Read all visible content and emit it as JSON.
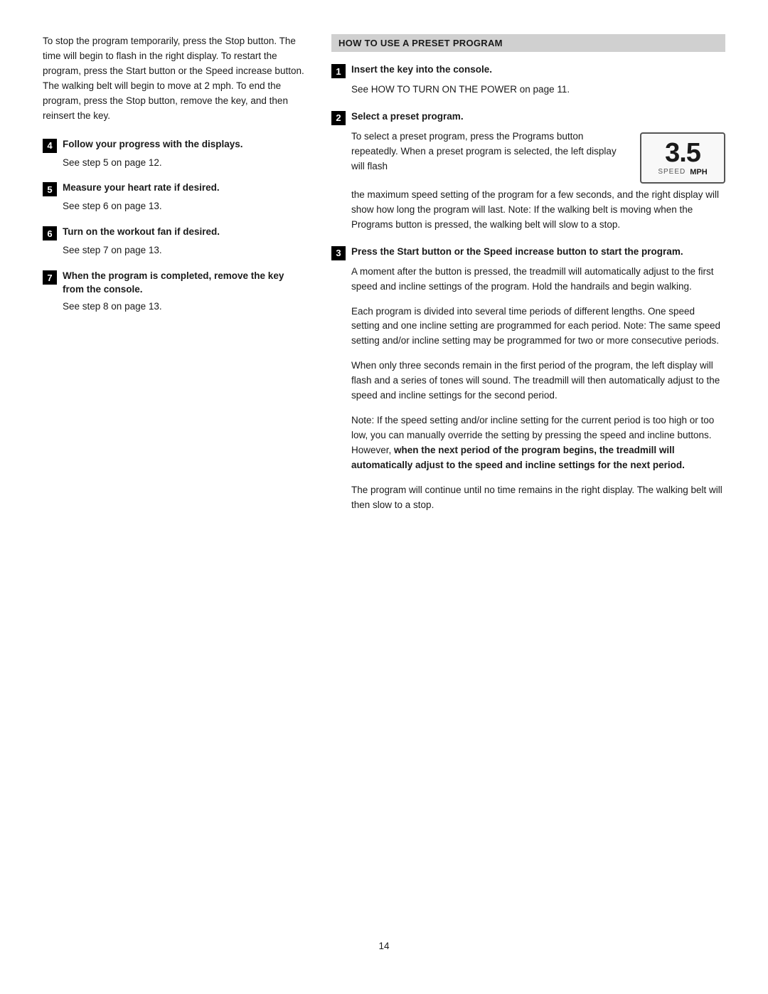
{
  "left": {
    "intro": "To stop the program temporarily, press the Stop button. The time will begin to flash in the right display. To restart the program, press the Start button or the Speed increase button. The walking belt will begin to move at 2 mph. To end the program, press the Stop button, remove the key, and then reinsert the key.",
    "steps": [
      {
        "number": "4",
        "title": "Follow your progress with the displays.",
        "body": "See step 5 on page 12."
      },
      {
        "number": "5",
        "title": "Measure your heart rate if desired.",
        "body": "See step 6 on page 13."
      },
      {
        "number": "6",
        "title": "Turn on the workout fan if desired.",
        "body": "See step 7 on page 13."
      },
      {
        "number": "7",
        "title": "When the program is completed, remove the key from the console.",
        "body": "See step 8 on page 13."
      }
    ]
  },
  "right": {
    "section_title": "HOW TO USE A PRESET PROGRAM",
    "steps": [
      {
        "number": "1",
        "title": "Insert the key into the console.",
        "body": "See HOW TO TURN ON THE POWER on page 11.",
        "has_image": false
      },
      {
        "number": "2",
        "title": "Select a preset program.",
        "body_before": "To select a preset program, press the Programs button repeatedly. When a preset program is selected, the left display will flash",
        "body_after": "the maximum speed setting of the program for a few seconds, and the right display will show how long the program will last. Note: If the walking belt is moving when the Programs button is pressed, the walking belt will slow to a stop.",
        "has_image": true,
        "speed_display": {
          "number": "3.5",
          "label": "SPEED",
          "unit": "MPH"
        }
      },
      {
        "number": "3",
        "title": "Press the Start button or the Speed increase button to start the program.",
        "paragraphs": [
          "A moment after the button is pressed, the treadmill will automatically adjust to the first speed and incline settings of the program. Hold the handrails and begin walking.",
          "Each program is divided into several time periods of different lengths. One speed setting and one incline setting are programmed for each period. Note: The same speed setting and/or incline setting may be programmed for two or more consecutive periods.",
          "When only three seconds remain in the first period of the program, the left display will flash and a series of tones will sound. The treadmill will then automatically adjust to the speed and incline settings for the second period.",
          "Note: If the speed setting and/or incline setting for the current period is too high or too low, you can manually override the setting by pressing the speed and incline buttons. However, __BOLD_START__when the next period of the program begins, the treadmill will automatically adjust to the speed and incline settings for the next period.__BOLD_END__",
          "The program will continue until no time remains in the right display. The walking belt will then slow to a stop."
        ]
      }
    ]
  },
  "page_number": "14"
}
